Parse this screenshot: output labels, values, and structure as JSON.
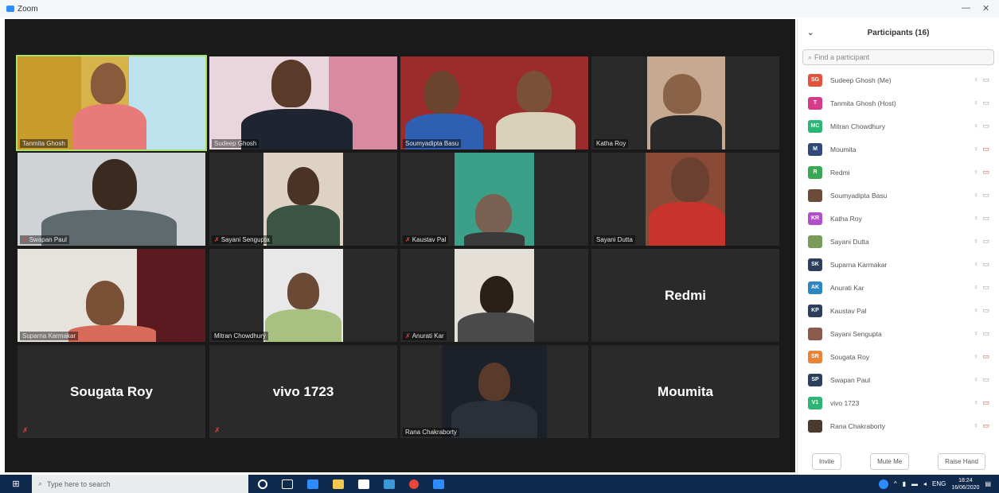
{
  "window": {
    "title": "Zoom"
  },
  "tiles": [
    {
      "name": "Tanmita Ghosh",
      "muted": false,
      "active": true
    },
    {
      "name": "Sudeep Ghosh",
      "muted": false
    },
    {
      "name": "Soumyadipta Basu",
      "muted": false
    },
    {
      "name": "Katha Roy",
      "muted": false
    },
    {
      "name": "Swapan Paul",
      "muted": true
    },
    {
      "name": "Sayani Sengupta",
      "muted": true
    },
    {
      "name": "Kaustav Pal",
      "muted": true
    },
    {
      "name": "Sayani Dutta",
      "muted": false
    },
    {
      "name": "Suparna Karmakar",
      "muted": false
    },
    {
      "name": "Mitran Chowdhury",
      "muted": false
    },
    {
      "name": "Anurati Kar",
      "muted": true
    },
    {
      "name": "Redmi",
      "muted": false,
      "big": true
    },
    {
      "name": "Sougata Roy",
      "muted": true,
      "big": true
    },
    {
      "name": "vivo 1723",
      "muted": true,
      "big": true
    },
    {
      "name": "Rana Chakraborty",
      "muted": false
    },
    {
      "name": "Moumita",
      "muted": false,
      "big": true
    }
  ],
  "panel": {
    "title": "Participants (16)",
    "search_placeholder": "Find a participant",
    "participants": [
      {
        "initials": "SG",
        "name": "Sudeep Ghosh (Me)",
        "color": "#e2543e",
        "video": "on"
      },
      {
        "initials": "T",
        "name": "Tanmita Ghosh (Host)",
        "color": "#d63c8a",
        "video": "on"
      },
      {
        "initials": "MC",
        "name": "Mitran Chowdhury",
        "color": "#2bb673",
        "video": "on"
      },
      {
        "initials": "M",
        "name": "Moumita",
        "color": "#2f4a7a",
        "video": "off"
      },
      {
        "initials": "R",
        "name": "Redmi",
        "color": "#3aa757",
        "video": "off"
      },
      {
        "initials": "",
        "name": "Soumyadipta Basu",
        "color": "#6b4b3a",
        "video": "on"
      },
      {
        "initials": "KR",
        "name": "Katha Roy",
        "color": "#b24fc7",
        "video": "on"
      },
      {
        "initials": "",
        "name": "Sayani Dutta",
        "color": "#7a9a5a",
        "video": "on"
      },
      {
        "initials": "SK",
        "name": "Suparna Karmakar",
        "color": "#2b3e5c",
        "video": "on"
      },
      {
        "initials": "AK",
        "name": "Anurati Kar",
        "color": "#2e86c1",
        "video": "on"
      },
      {
        "initials": "KP",
        "name": "Kaustav Pal",
        "color": "#2b3e5c",
        "video": "on"
      },
      {
        "initials": "",
        "name": "Sayani Sengupta",
        "color": "#8a5a4a",
        "video": "on"
      },
      {
        "initials": "SR",
        "name": "Sougata Roy",
        "color": "#e8843a",
        "video": "off"
      },
      {
        "initials": "SP",
        "name": "Swapan Paul",
        "color": "#2b3e5c",
        "video": "on"
      },
      {
        "initials": "V1",
        "name": "vivo 1723",
        "color": "#2bb673",
        "video": "off"
      },
      {
        "initials": "",
        "name": "Rana Chakraborty",
        "color": "#4a3a30",
        "video": "off"
      }
    ],
    "invite_label": "Invite",
    "mute_me_label": "Mute Me",
    "raise_hand_label": "Raise Hand"
  },
  "taskbar": {
    "search_placeholder": "Type here to search",
    "lang": "ENG",
    "time": "18:24",
    "date": "16/06/2020"
  }
}
